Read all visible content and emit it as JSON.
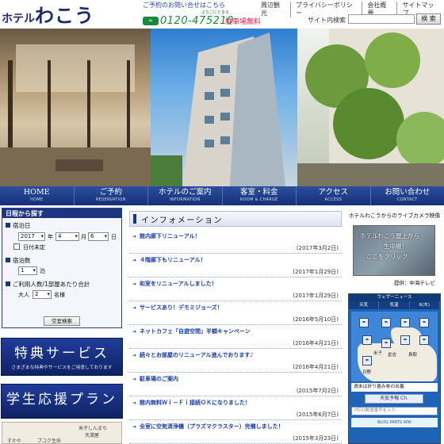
{
  "header": {
    "logo_small": "ホテル",
    "logo_big": "わこう",
    "contact_text": "ご予約のお問い合せはこちら",
    "freedial_tag": "よなごにとまる",
    "freedial_icon": "freedial-icon",
    "phone": "0120-475210",
    "parking": "駐車場無料",
    "top_links": [
      "周辺観光",
      "プライバシーポリシー",
      "会社概要",
      "サイトマップ"
    ],
    "search_label": "サイト内検索",
    "search_placeholder": "",
    "search_button": "検 索"
  },
  "nav": [
    {
      "title": "HOME",
      "sub": "HOME"
    },
    {
      "title": "ご予約",
      "sub": "RESERVATION"
    },
    {
      "title": "ホテルのご案内",
      "sub": "INFORMATION"
    },
    {
      "title": "客室・料金",
      "sub": "ROOM & CHARGE"
    },
    {
      "title": "アクセス",
      "sub": "ACCESS"
    },
    {
      "title": "お問い合わせ",
      "sub": "CONTACT"
    }
  ],
  "booking": {
    "title": "日程から探す",
    "stay_date_label": "宿泊日",
    "year": "2017",
    "year_unit": "年",
    "month": "4",
    "month_unit": "月",
    "day": "6",
    "day_unit": "日",
    "undecided_label": "日付未定",
    "nights_label": "宿泊数",
    "nights_value": "1",
    "nights_unit": "泊",
    "people_label": "ご利用人数/1部屋あたり合計",
    "adult_label": "大人",
    "adult_value": "2",
    "adult_unit": "名様",
    "search_button": "空室検索"
  },
  "banners": [
    {
      "title": "特典サービス",
      "sub": "さまざまな特典やサービスをご用意しております"
    },
    {
      "title": "学生応援プラン",
      "sub": ""
    }
  ],
  "map_strip": {
    "place1": "米子しんまち",
    "place2": "天満屋",
    "place3": "すかや",
    "place4": "ブコク生命"
  },
  "info": {
    "title": "インフォメーション",
    "items": [
      {
        "text": "館内廊下リニューアル！",
        "date": "(2017年3月2日)"
      },
      {
        "text": "４階廊下もリニューアル！",
        "date": "(2017年1月29日)"
      },
      {
        "text": "和室をリニューアルしました！",
        "date": "(2017年1月29日)"
      },
      {
        "text": "サービスあり！デモミジョーズ！",
        "date": "(2016年5月10日)"
      },
      {
        "text": "ネットカフェ「自遊空間」半額キャンペーン",
        "date": "(2016年4月21日)"
      },
      {
        "text": "続々とお部屋のリニューアル進んでおります♪",
        "date": "(2016年4月21日)"
      },
      {
        "text": "駐車場のご案内",
        "date": "(2015年7月2日)"
      },
      {
        "text": "館内無料Ｗｉ－Ｆｉ接続ＯＫになりました！",
        "date": "(2015年6月7日)"
      },
      {
        "text": "全室に空気清浄機（プラズマクラスター）完備しました！",
        "date": "(2015年3月23日)"
      }
    ]
  },
  "live": {
    "title": "ホテルわこうからのライブカメラ映像",
    "line1": "ホテルわこう屋上から",
    "line2": "生中継！",
    "line3": "ここをクリック",
    "provider": "提供：中海テレビ"
  },
  "weather": {
    "head": "ウェザーニュース",
    "tab_weather": "天気",
    "tab_temp": "気温",
    "tab_date": "6(木)",
    "region1": "日野",
    "region2": "倉吉",
    "region3": "米子",
    "region4": "鳥取",
    "foot": "週末は折り畳み傘の出番",
    "forecast_button": "天気予報 Ch.",
    "input_placeholder": "7桁の郵便番号を入力",
    "ad": "BLOG PARTS WNI"
  }
}
